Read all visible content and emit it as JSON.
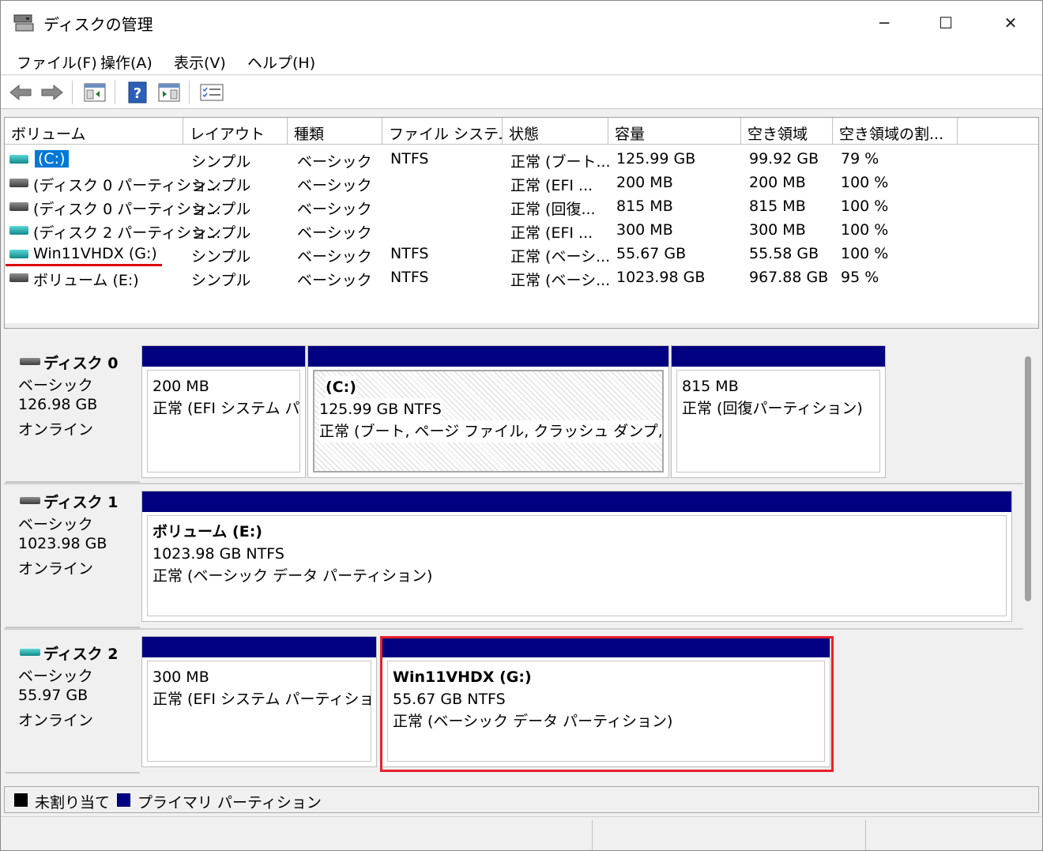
{
  "window": {
    "title": "ディスクの管理",
    "minimize_glyph": "─",
    "maximize_glyph": "☐",
    "close_glyph": "✕"
  },
  "menu": [
    "ファイル(F)",
    "操作(A)",
    "表示(V)",
    "ヘルプ(H)"
  ],
  "toolbar": {
    "items": [
      "back-arrow-icon",
      "forward-arrow-icon",
      "properties-icon",
      "help-icon",
      "action-pane-icon",
      "checklist-icon"
    ]
  },
  "volume_list": {
    "columns": [
      "ボリューム",
      "レイアウト",
      "種類",
      "ファイル システム",
      "状態",
      "容量",
      "空き領域",
      "空き領域の割..."
    ],
    "rows": [
      {
        "name": "(C:)",
        "layout": "シンプル",
        "type": "ベーシック",
        "fs": "NTFS",
        "status": "正常 (ブート...",
        "capacity": "125.99 GB",
        "free": "99.92 GB",
        "pct": "79 %",
        "icon": "teal-drive-icon"
      },
      {
        "name": "(ディスク 0 パーティショ...",
        "layout": "シンプル",
        "type": "ベーシック",
        "fs": "",
        "status": "正常 (EFI ...",
        "capacity": "200 MB",
        "free": "200 MB",
        "pct": "100 %",
        "icon": "gray-drive-icon"
      },
      {
        "name": "(ディスク 0 パーティショ...",
        "layout": "シンプル",
        "type": "ベーシック",
        "fs": "",
        "status": "正常 (回復...",
        "capacity": "815 MB",
        "free": "815 MB",
        "pct": "100 %",
        "icon": "gray-drive-icon"
      },
      {
        "name": "(ディスク 2 パーティショ...",
        "layout": "シンプル",
        "type": "ベーシック",
        "fs": "",
        "status": "正常 (EFI ...",
        "capacity": "300 MB",
        "free": "300 MB",
        "pct": "100 %",
        "icon": "teal-drive-icon"
      },
      {
        "name": "Win11VHDX (G:)",
        "layout": "シンプル",
        "type": "ベーシック",
        "fs": "NTFS",
        "status": "正常 (ベーシ...",
        "capacity": "55.67 GB",
        "free": "55.58 GB",
        "pct": "100 %",
        "icon": "teal-drive-icon"
      },
      {
        "name": "ボリューム (E:)",
        "layout": "シンプル",
        "type": "ベーシック",
        "fs": "NTFS",
        "status": "正常 (ベーシ...",
        "capacity": "1023.98 GB",
        "free": "967.88 GB",
        "pct": "95 %",
        "icon": "gray-drive-icon"
      }
    ]
  },
  "disks": [
    {
      "name": "ディスク 0",
      "type": "ベーシック",
      "size": "126.98 GB",
      "state": "オンライン",
      "partitions": [
        {
          "label": "",
          "size": "200 MB",
          "desc": "正常 (EFI システム パー"
        },
        {
          "label": "(C:)",
          "size": "125.99 GB NTFS",
          "desc": "正常 (ブート, ページ ファイル, クラッシュ ダンプ, ベーシック"
        },
        {
          "label": "",
          "size": "815 MB",
          "desc": "正常 (回復パーティション)"
        }
      ]
    },
    {
      "name": "ディスク 1",
      "type": "ベーシック",
      "size": "1023.98 GB",
      "state": "オンライン",
      "partitions": [
        {
          "label": "ボリューム  (E:)",
          "size": "1023.98 GB NTFS",
          "desc": "正常 (ベーシック データ パーティション)"
        }
      ]
    },
    {
      "name": "ディスク 2",
      "type": "ベーシック",
      "size": "55.97 GB",
      "state": "オンライン",
      "partitions": [
        {
          "label": "",
          "size": "300 MB",
          "desc": "正常 (EFI システム パーティション)"
        },
        {
          "label": "Win11VHDX  (G:)",
          "size": "55.67 GB NTFS",
          "desc": "正常 (ベーシック データ パーティション)"
        }
      ]
    }
  ],
  "legend": [
    {
      "label": "未割り当て",
      "color": "#000000"
    },
    {
      "label": "プライマリ パーティション",
      "color": "#000080"
    }
  ],
  "colors": {
    "partition_bar": "#000080",
    "selection": "#0078d7",
    "highlight_red": "#e8202a"
  }
}
